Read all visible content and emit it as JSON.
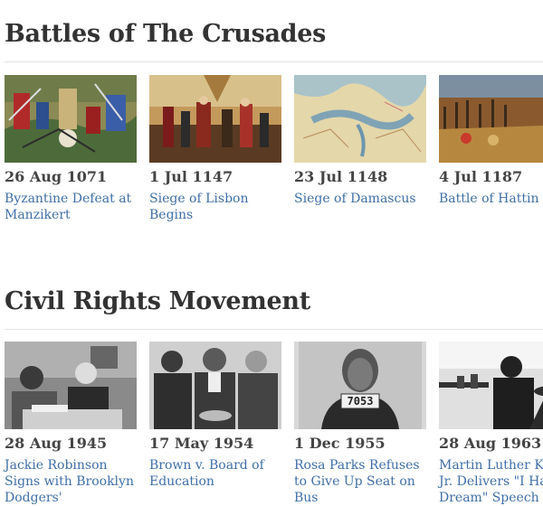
{
  "sections": [
    {
      "title": "Battles of The Crusades",
      "events": [
        {
          "date": "26 Aug 1071",
          "title_line1": "Byzantine Defeat at",
          "title_line2": "Manzikert",
          "thumbnail": "medieval-battle-painting-thumbnail"
        },
        {
          "date": "1 Jul 1147",
          "title_line1": "Siege of Lisbon",
          "title_line2": "Begins",
          "thumbnail": "royal-court-painting-thumbnail"
        },
        {
          "date": "23 Jul 1148",
          "title_line1": "Siege of Damascus",
          "title_line2": "",
          "thumbnail": "old-map-thumbnail"
        },
        {
          "date": "4 Jul 1187",
          "title_line1": "Battle of Hattin",
          "title_line2": "",
          "thumbnail": "army-battle-painting-thumbnail"
        }
      ]
    },
    {
      "title": "Civil Rights Movement",
      "events": [
        {
          "date": "28 Aug 1945",
          "title_line1": "Jackie Robinson",
          "title_line2": "Signs with Brooklyn",
          "title_line3": "Dodgers'",
          "thumbnail": "contract-signing-photo-thumbnail"
        },
        {
          "date": "17 May 1954",
          "title_line1": "Brown v. Board of",
          "title_line2": "Education",
          "thumbnail": "lawyers-handshake-photo-thumbnail"
        },
        {
          "date": "1 Dec 1955",
          "title_line1": "Rosa Parks Refuses",
          "title_line2": "to Give Up Seat on",
          "title_line3": "Bus",
          "thumbnail": "mugshot-photo-thumbnail",
          "placard_text": "7053"
        },
        {
          "date": "28 Aug 1963",
          "title_line1": "Martin Luther Ki",
          "title_line2": "Jr. Delivers \"I Ha",
          "title_line3": "Dream\" Speech",
          "thumbnail": "speech-microphones-photo-thumbnail"
        }
      ]
    }
  ]
}
